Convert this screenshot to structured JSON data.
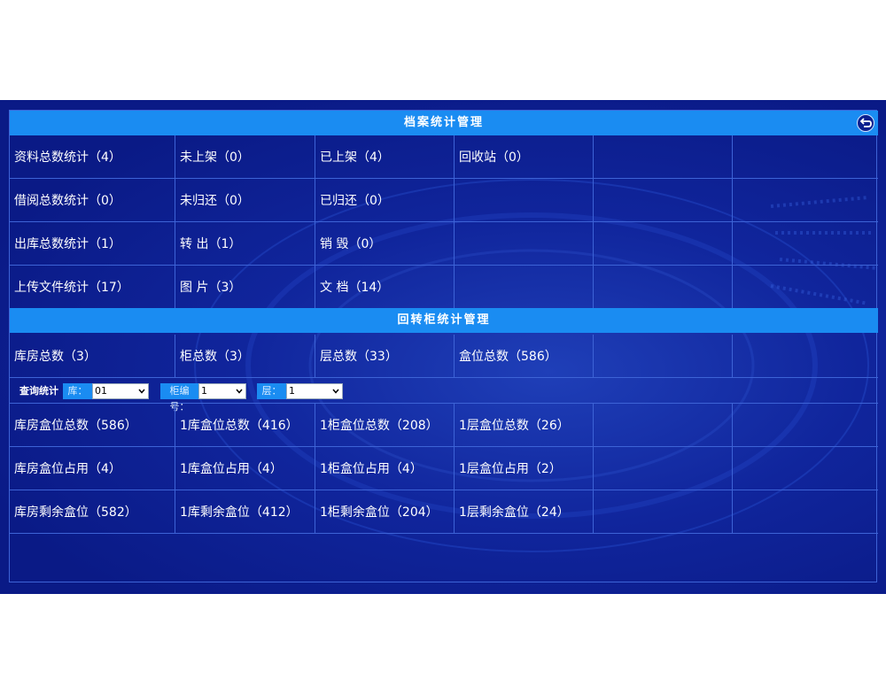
{
  "archive_section": {
    "title": "档案统计管理",
    "rows": [
      [
        "资料总数统计（4）",
        "未上架（0）",
        "已上架（4）",
        "回收站（0）",
        "",
        ""
      ],
      [
        "借阅总数统计（0）",
        "未归还（0）",
        "已归还（0）",
        "",
        "",
        ""
      ],
      [
        "出库总数统计（1）",
        "转 出（1）",
        "销 毁（0）",
        "",
        "",
        ""
      ],
      [
        "上传文件统计（17）",
        "图 片（3）",
        "文 档（14）",
        "",
        "",
        ""
      ]
    ]
  },
  "rotary_section": {
    "title": "回转柜统计管理",
    "summary_row": [
      "库房总数（3）",
      "柜总数（3）",
      "层总数（33）",
      "盒位总数（586）",
      "",
      ""
    ]
  },
  "filter": {
    "label": "查询统计",
    "library_label": "库：",
    "library_value": "01",
    "cabinet_label": "柜编号：",
    "cabinet_value": "1",
    "layer_label": "层：",
    "layer_value": "1"
  },
  "detail_rows": [
    [
      "库房盒位总数（586）",
      "1库盒位总数（416）",
      "1柜盒位总数（208）",
      "1层盒位总数（26）",
      "",
      ""
    ],
    [
      "库房盒位占用（4）",
      "1库盒位占用（4）",
      "1柜盒位占用（4）",
      "1层盒位占用（2）",
      "",
      ""
    ],
    [
      "库房剩余盒位（582）",
      "1库剩余盒位（412）",
      "1柜剩余盒位（204）",
      "1层剩余盒位（24）",
      "",
      ""
    ]
  ],
  "colors": {
    "background": "#0a1a86",
    "header": "#1a8cf2",
    "grid_line": "#3d63d6"
  },
  "icons": {
    "back": "back-arrow-icon",
    "dropdown": "chevron-down-icon"
  }
}
